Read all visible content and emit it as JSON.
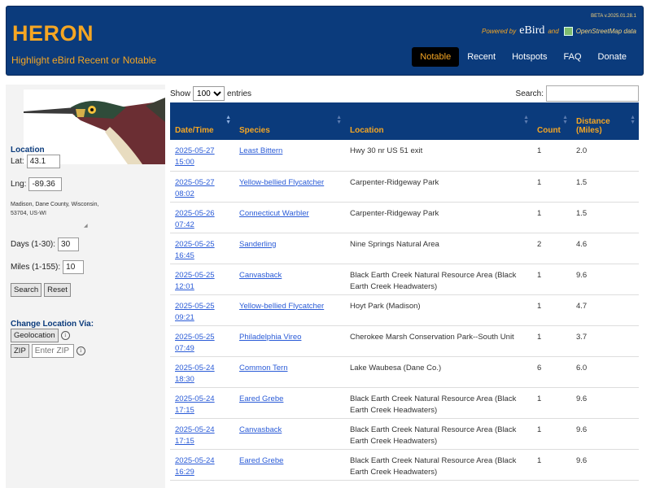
{
  "header": {
    "title": "HERON",
    "subtitle": "Highlight eBird Recent or Notable",
    "version": "BETA v.2025.01.28.1",
    "powered_by": "Powered by",
    "ebird": "eBird",
    "and": "and",
    "osm": "OpenStreetMap data",
    "nav": [
      "Notable",
      "Recent",
      "Hotspots",
      "FAQ",
      "Donate"
    ],
    "active_nav": "Notable"
  },
  "sidebar": {
    "location_heading": "Location",
    "lat_label": "Lat:",
    "lat_value": "43.1",
    "lng_label": "Lng:",
    "lng_value": "-89.36",
    "address": "Madison, Dane County, Wisconsin, 53704, US-WI",
    "days_label": "Days (1-30):",
    "days_value": "30",
    "miles_label": "Miles (1-155):",
    "miles_value": "10",
    "search_button": "Search",
    "reset_button": "Reset",
    "change_heading": "Change Location Via:",
    "geolocation_button": "Geolocation",
    "zip_button": "ZIP",
    "zip_placeholder": "Enter ZIP",
    "info_glyph": "i"
  },
  "table_controls": {
    "show_label": "Show",
    "entries_value": "100",
    "entries_label": "entries",
    "search_label": "Search:"
  },
  "table": {
    "headers": {
      "datetime": "Date/Time",
      "species": "Species",
      "location": "Location",
      "count": "Count",
      "distance_1": "Distance",
      "distance_2": "(Miles)"
    },
    "rows": [
      {
        "date": "2025-05-27",
        "time": "15:00",
        "species": "Least Bittern",
        "location": "Hwy 30 nr US 51 exit",
        "count": "1",
        "distance": "2.0"
      },
      {
        "date": "2025-05-27",
        "time": "08:02",
        "species": "Yellow-bellied Flycatcher",
        "location": "Carpenter-Ridgeway Park",
        "count": "1",
        "distance": "1.5"
      },
      {
        "date": "2025-05-26",
        "time": "07:42",
        "species": "Connecticut Warbler",
        "location": "Carpenter-Ridgeway Park",
        "count": "1",
        "distance": "1.5"
      },
      {
        "date": "2025-05-25",
        "time": "16:45",
        "species": "Sanderling",
        "location": "Nine Springs Natural Area",
        "count": "2",
        "distance": "4.6"
      },
      {
        "date": "2025-05-25",
        "time": "12:01",
        "species": "Canvasback",
        "location": "Black Earth Creek Natural Resource Area (Black Earth Creek Headwaters)",
        "count": "1",
        "distance": "9.6"
      },
      {
        "date": "2025-05-25",
        "time": "09:21",
        "species": "Yellow-bellied Flycatcher",
        "location": "Hoyt Park (Madison)",
        "count": "1",
        "distance": "4.7"
      },
      {
        "date": "2025-05-25",
        "time": "07:49",
        "species": "Philadelphia Vireo",
        "location": "Cherokee Marsh Conservation Park--South Unit",
        "count": "1",
        "distance": "3.7"
      },
      {
        "date": "2025-05-24",
        "time": "18:30",
        "species": "Common Tern",
        "location": "Lake Waubesa (Dane Co.)",
        "count": "6",
        "distance": "6.0"
      },
      {
        "date": "2025-05-24",
        "time": "17:15",
        "species": "Eared Grebe",
        "location": "Black Earth Creek Natural Resource Area (Black Earth Creek Headwaters)",
        "count": "1",
        "distance": "9.6"
      },
      {
        "date": "2025-05-24",
        "time": "17:15",
        "species": "Canvasback",
        "location": "Black Earth Creek Natural Resource Area (Black Earth Creek Headwaters)",
        "count": "1",
        "distance": "9.6"
      },
      {
        "date": "2025-05-24",
        "time": "16:29",
        "species": "Eared Grebe",
        "location": "Black Earth Creek Natural Resource Area (Black Earth Creek Headwaters)",
        "count": "1",
        "distance": "9.6"
      }
    ]
  },
  "colors": {
    "brand_blue": "#0b3b7c",
    "accent_orange": "#f5a623",
    "link_blue": "#2a5bd7"
  }
}
